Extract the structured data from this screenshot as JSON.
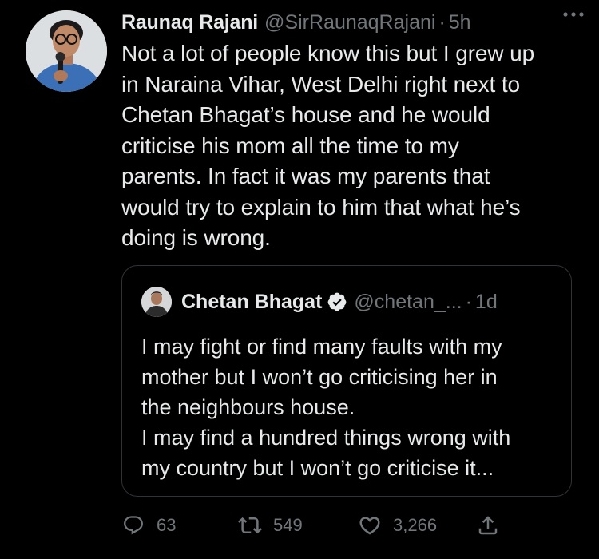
{
  "tweet": {
    "author_name": "Raunaq Rajani",
    "author_handle": "@SirRaunaqRajani",
    "separator": "·",
    "time": "5h",
    "text": "Not a lot of people know this but I grew up\nin Naraina Vihar, West Delhi right next to\nChetan Bhagat’s house and he would\ncriticise his mom all the time to my\nparents. In fact it was my parents that\nwould try to explain to him that what he’s\ndoing is wrong.",
    "more_icon": "more-horizontal-icon"
  },
  "quote": {
    "author_name": "Chetan Bhagat",
    "author_handle": "@chetan_...",
    "separator": "·",
    "time": "1d",
    "verified_icon": "verified-badge-icon",
    "text": "I may fight or find many faults  with my\nmother  but I won’t go criticising her in\nthe neighbours house.\nI may find a hundred things wrong with\nmy country but I won’t go criticise it..."
  },
  "actions": {
    "reply_count": "63",
    "retweet_count": "549",
    "like_count": "3,266",
    "icons": [
      "reply-icon",
      "retweet-icon",
      "like-icon",
      "share-icon"
    ]
  },
  "colors": {
    "background": "#000000",
    "text": "#e7e9ea",
    "muted": "#71767b",
    "border": "#2f3336",
    "avatar_shirt": "#3b6fb6"
  }
}
